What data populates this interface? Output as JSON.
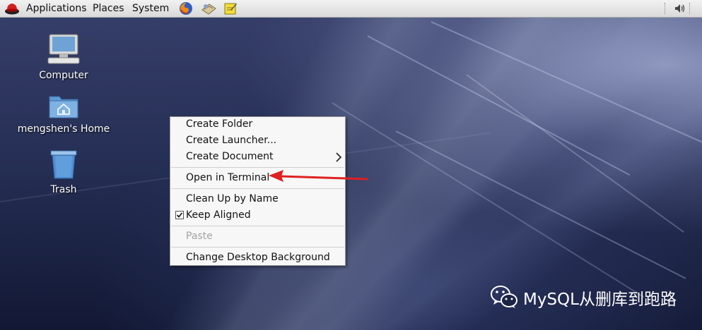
{
  "top_panel": {
    "menus": [
      "Applications",
      "Places",
      "System"
    ],
    "launchers": [
      "firefox-icon",
      "mail-icon",
      "notes-icon"
    ],
    "tray": [
      "volume-icon"
    ]
  },
  "desktop_icons": [
    {
      "label": "Computer",
      "icon": "computer-icon"
    },
    {
      "label": "mengshen's Home",
      "icon": "home-folder-icon"
    },
    {
      "label": "Trash",
      "icon": "trash-icon"
    }
  ],
  "context_menu": {
    "items": [
      {
        "label": "Create Folder"
      },
      {
        "label": "Create Launcher..."
      },
      {
        "label": "Create Document",
        "submenu": true
      },
      {
        "label": "Open in Terminal",
        "highlighted_by_arrow": true
      },
      {
        "label": "Clean Up by Name"
      },
      {
        "label": "Keep Aligned",
        "checked": true
      },
      {
        "label": "Paste",
        "disabled": true
      },
      {
        "label": "Change Desktop Background"
      }
    ]
  },
  "annotation": {
    "arrow_color": "#e02020"
  },
  "watermark": {
    "text": "MySQL从删库到跑路",
    "icon": "wechat-icon"
  }
}
